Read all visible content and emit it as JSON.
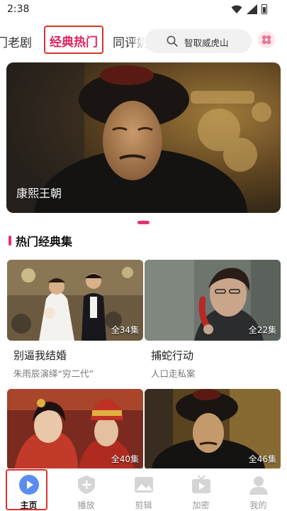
{
  "status_bar": {
    "time": "2:38"
  },
  "tabs": {
    "left": "门老剧",
    "active": "经典热门",
    "right": "同评奶"
  },
  "search": {
    "placeholder": "智取威虎山"
  },
  "banner": {
    "caption": "康熙王朝"
  },
  "section": {
    "title": "热门经典集"
  },
  "cards": [
    {
      "title": "别逼我结婚",
      "subtitle": "朱雨辰演绎“穷二代”",
      "badge": "全34集"
    },
    {
      "title": "捕蛇行动",
      "subtitle": "人口走私案",
      "badge": "全22集"
    },
    {
      "badge": "全40集"
    },
    {
      "badge": "全46集"
    }
  ],
  "nav": [
    {
      "label": "主页",
      "icon": "play-circle-icon"
    },
    {
      "label": "播放",
      "icon": "shield-plus-icon"
    },
    {
      "label": "剪辑",
      "icon": "image-icon"
    },
    {
      "label": "加密",
      "icon": "tv-play-icon"
    },
    {
      "label": "我的",
      "icon": "user-icon"
    }
  ],
  "colors": {
    "accent": "#e6336f",
    "highlight_box": "#d9342b"
  }
}
